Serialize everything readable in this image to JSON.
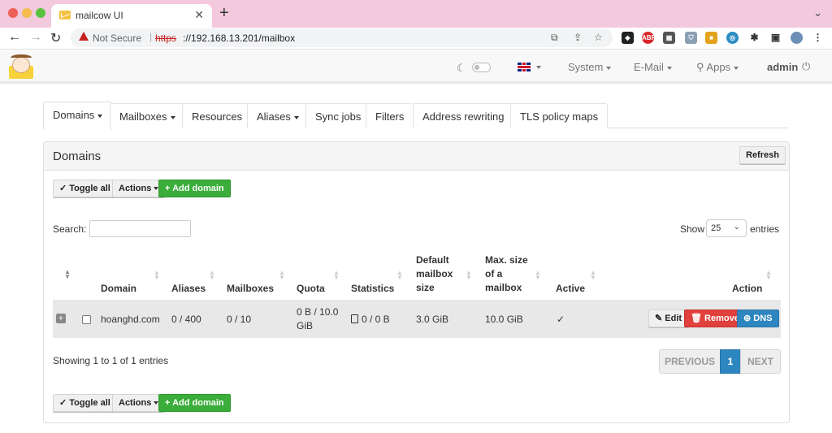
{
  "browser": {
    "tab_title": "mailcow UI",
    "not_secure": "Not Secure",
    "url_scheme": "https",
    "url_rest": "://192.168.13.201/mailbox",
    "extensions": [
      "ABP"
    ]
  },
  "navbar": {
    "system": "System",
    "email": "E-Mail",
    "apps": "Apps",
    "user": "admin"
  },
  "tabs": [
    {
      "label": "Domains",
      "dropdown": true,
      "active": true
    },
    {
      "label": "Mailboxes",
      "dropdown": true
    },
    {
      "label": "Resources"
    },
    {
      "label": "Aliases",
      "dropdown": true
    },
    {
      "label": "Sync jobs"
    },
    {
      "label": "Filters"
    },
    {
      "label": "Address rewriting"
    },
    {
      "label": "TLS policy maps"
    }
  ],
  "panel": {
    "title": "Domains",
    "refresh": "Refresh",
    "toggle_all": "Toggle all",
    "actions": "Actions",
    "add_domain": "Add domain",
    "search_label": "Search:",
    "show_label": "Show",
    "entries_value": "25",
    "entries_label": "entries"
  },
  "table": {
    "headers": {
      "domain": "Domain",
      "aliases": "Aliases",
      "mailboxes": "Mailboxes",
      "quota": "Quota",
      "statistics": "Statistics",
      "default_size_1": "Default",
      "default_size_2": "mailbox",
      "default_size_3": "size",
      "max_size_1": "Max. size",
      "max_size_2": "of a",
      "max_size_3": "mailbox",
      "active": "Active",
      "action": "Action"
    },
    "rows": [
      {
        "domain": "hoanghd.com",
        "aliases": "0 / 400",
        "mailboxes": "0 / 10",
        "quota_1": "0 B / 10.0",
        "quota_2": "GiB",
        "statistics": "0 / 0 B",
        "default_size": "3.0 GiB",
        "max_size": "10.0 GiB",
        "active": "✓",
        "edit": "Edit",
        "remove": "Remove",
        "dns": "DNS"
      }
    ]
  },
  "footer": {
    "showing": "Showing 1 to 1 of 1 entries",
    "previous": "PREVIOUS",
    "page": "1",
    "next": "NEXT"
  },
  "colors": {
    "tabstrip": "#f3c9dd",
    "add_green": "#3aad3a",
    "remove_red": "#e0413c",
    "dns_blue": "#2e86c1",
    "page_active": "#2e86c1"
  }
}
